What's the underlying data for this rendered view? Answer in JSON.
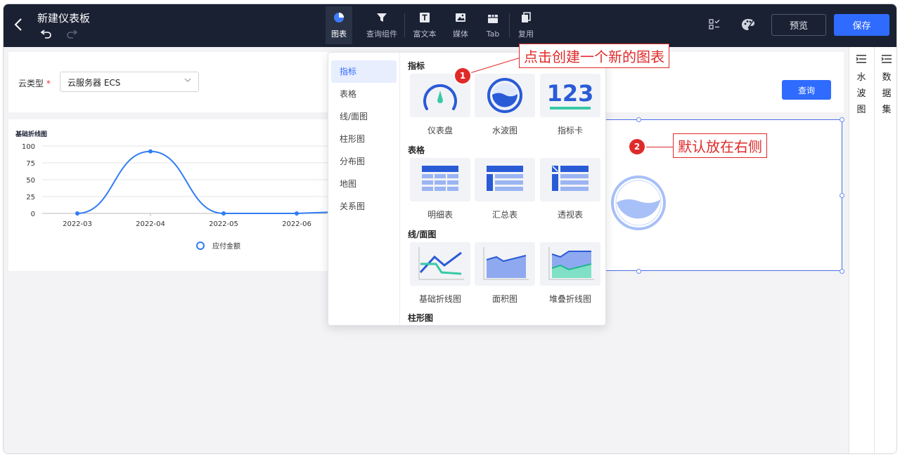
{
  "topbar": {
    "title": "新建仪表板",
    "back_icon": "back-arrow-icon",
    "tools": [
      {
        "label": "图表",
        "icon": "pie-chart-icon",
        "active": true
      },
      {
        "label": "查询组件",
        "icon": "filter-icon"
      },
      {
        "label": "富文本",
        "icon": "text-icon"
      },
      {
        "label": "媒体",
        "icon": "image-icon"
      },
      {
        "label": "Tab",
        "icon": "tab-icon"
      },
      {
        "label": "复用",
        "icon": "copy-icon"
      }
    ],
    "preview_label": "预览",
    "save_label": "保存"
  },
  "filter": {
    "label": "云类型",
    "required_mark": "*",
    "value": "云服务器  ECS",
    "query_label": "查询"
  },
  "chart_data": {
    "type": "line",
    "title": "基础折线图",
    "x": [
      "2022-03",
      "2022-04",
      "2022-05",
      "2022-06"
    ],
    "series": [
      {
        "name": "应付金额",
        "values": [
          0,
          92,
          0,
          0
        ],
        "color": "#2f7cf6"
      }
    ],
    "yticks": [
      0,
      25,
      50,
      75,
      100
    ],
    "ylim": [
      0,
      100
    ],
    "grid": true,
    "legend": "bottom"
  },
  "dropdown": {
    "categories": [
      "指标",
      "表格",
      "线/面图",
      "柱形图",
      "分布图",
      "地图",
      "关系图"
    ],
    "active_category": "指标",
    "sections": [
      {
        "title": "指标",
        "items": [
          "仪表盘",
          "水波图",
          "指标卡"
        ]
      },
      {
        "title": "表格",
        "items": [
          "明细表",
          "汇总表",
          "透视表"
        ]
      },
      {
        "title": "线/面图",
        "items": [
          "基础折线图",
          "面积图",
          "堆叠折线图"
        ]
      },
      {
        "title": "柱形图",
        "items": []
      }
    ],
    "metric_card_text": "123"
  },
  "right_panel": {
    "tabs": [
      "水波图",
      "数据集"
    ]
  },
  "annotations": {
    "note1": {
      "num": "1",
      "text": "点击创建一个新的图表"
    },
    "note2": {
      "num": "2",
      "text": "默认放在右侧"
    }
  },
  "colors": {
    "primary": "#2f6bff",
    "topbar": "#1a2133",
    "annotation": "#e02a2a",
    "water": "#a8c0f8"
  }
}
